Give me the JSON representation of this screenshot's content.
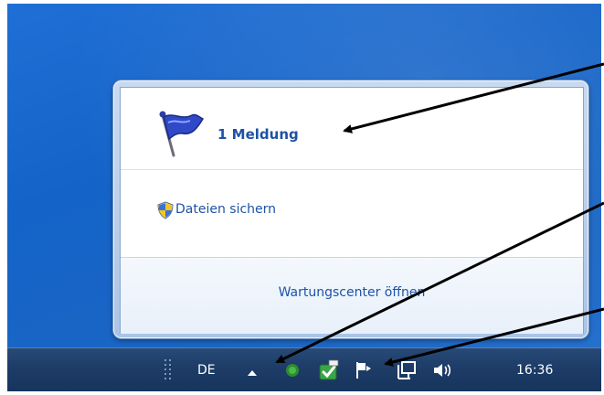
{
  "popup": {
    "messages_label": "1 Meldung",
    "backup_label": "Dateien sichern",
    "footer_link": "Wartungscenter öffnen"
  },
  "taskbar": {
    "language": "DE",
    "clock": "16:36"
  },
  "colors": {
    "link": "#1e52a6",
    "desktop": "#1463c8",
    "taskbar": "#1d3c67"
  },
  "icons": [
    "flag-icon",
    "shield-icon",
    "show-hidden-icons-icon",
    "security-essentials-icon",
    "update-icon",
    "action-center-flag-icon",
    "network-icon",
    "volume-icon"
  ]
}
